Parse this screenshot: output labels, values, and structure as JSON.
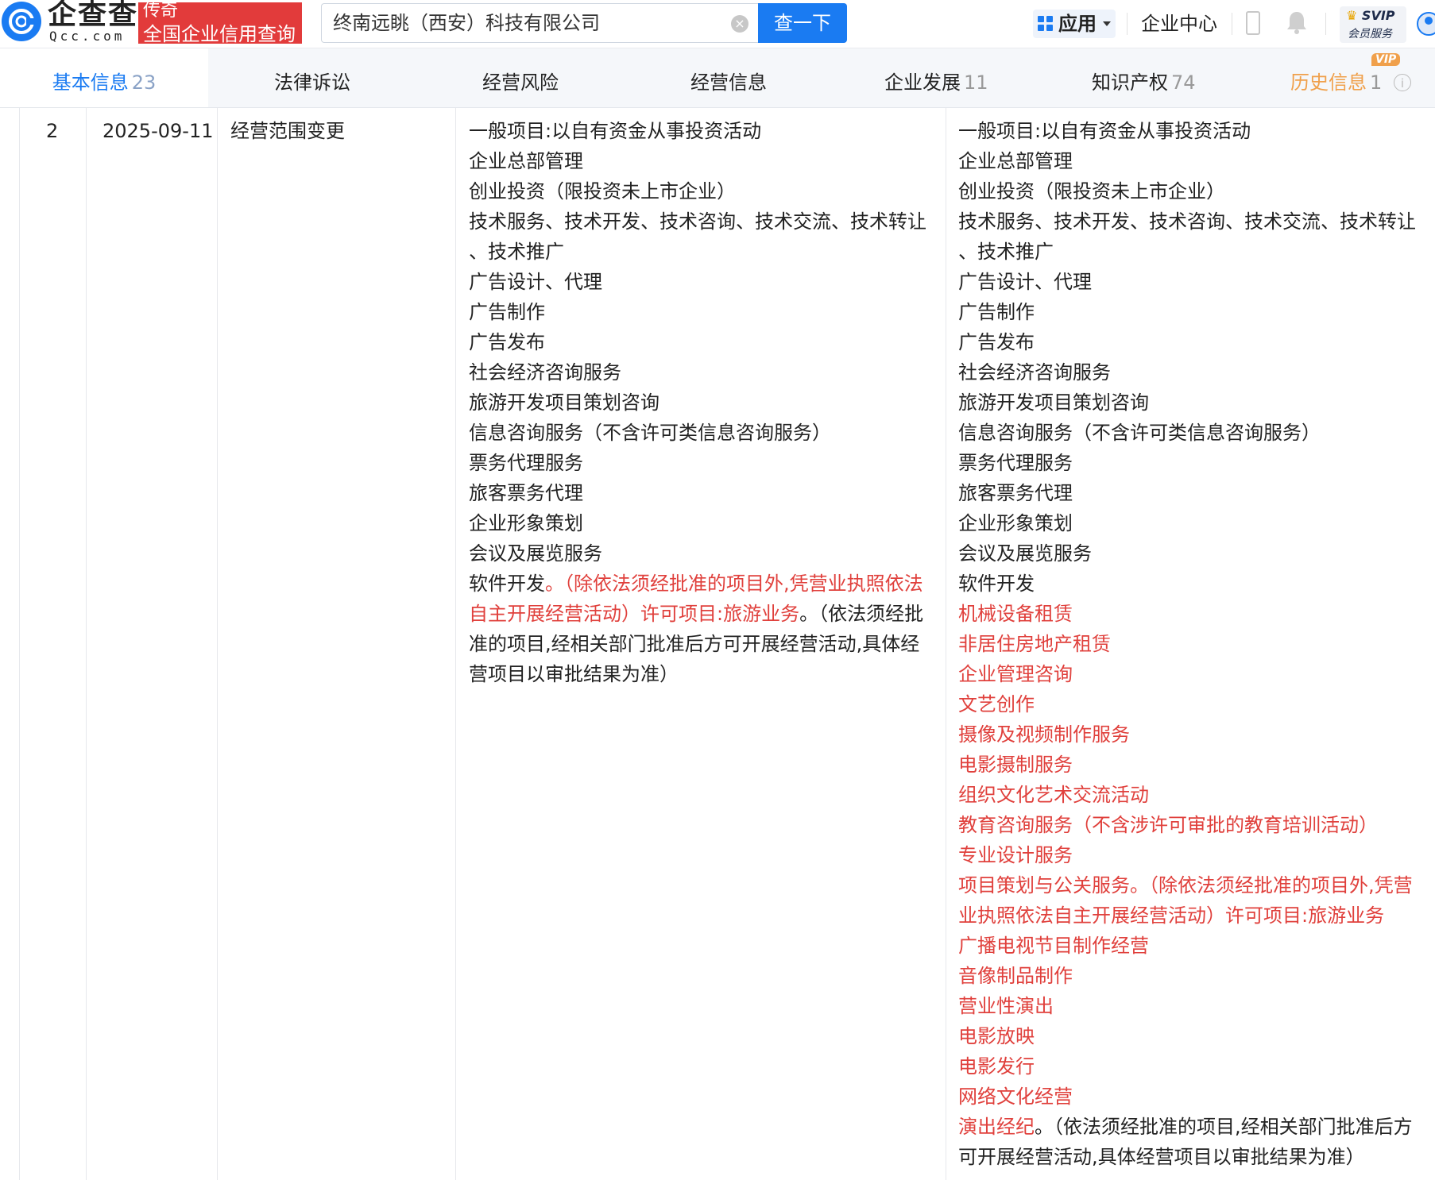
{
  "header": {
    "logo_text": "企查查",
    "logo_sub": "Qcc.com",
    "badge_top": "传奇",
    "badge_bottom": "全国企业信用查询",
    "search_value": "终南远眺（西安）科技有限公司",
    "search_button": "查一下",
    "app_label": "应用",
    "enterprise_center": "企业中心",
    "svip_title": "SVIP",
    "svip_sub": "会员服务"
  },
  "tabs": [
    {
      "label": "基本信息",
      "count": "23"
    },
    {
      "label": "法律诉讼",
      "count": ""
    },
    {
      "label": "经营风险",
      "count": ""
    },
    {
      "label": "经营信息",
      "count": ""
    },
    {
      "label": "企业发展",
      "count": "11"
    },
    {
      "label": "知识产权",
      "count": "74"
    },
    {
      "label": "历史信息",
      "count": "1"
    }
  ],
  "vip_tag": "VIP",
  "record": {
    "index": "2",
    "date": "2025-09-11",
    "type": "经营范围变更",
    "before": [
      [
        {
          "t": "一般项目:以自有资金从事投资活动",
          "r": false
        }
      ],
      [
        {
          "t": "企业总部管理",
          "r": false
        }
      ],
      [
        {
          "t": "创业投资（限投资未上市企业）",
          "r": false
        }
      ],
      [
        {
          "t": "技术服务、技术开发、技术咨询、技术交流、技术转让",
          "r": false
        }
      ],
      [
        {
          "t": "、技术推广",
          "r": false
        }
      ],
      [
        {
          "t": "广告设计、代理",
          "r": false
        }
      ],
      [
        {
          "t": "广告制作",
          "r": false
        }
      ],
      [
        {
          "t": "广告发布",
          "r": false
        }
      ],
      [
        {
          "t": "社会经济咨询服务",
          "r": false
        }
      ],
      [
        {
          "t": "旅游开发项目策划咨询",
          "r": false
        }
      ],
      [
        {
          "t": "信息咨询服务（不含许可类信息咨询服务）",
          "r": false
        }
      ],
      [
        {
          "t": "票务代理服务",
          "r": false
        }
      ],
      [
        {
          "t": "旅客票务代理",
          "r": false
        }
      ],
      [
        {
          "t": "企业形象策划",
          "r": false
        }
      ],
      [
        {
          "t": "会议及展览服务",
          "r": false
        }
      ],
      [
        {
          "t": "软件开发",
          "r": false
        },
        {
          "t": "。（除依法须经批准的项目外,凭营业执照依法",
          "r": true
        }
      ],
      [
        {
          "t": "自主开展经营活动）许可项目:旅游业务",
          "r": true
        },
        {
          "t": "。（依法须经批",
          "r": false
        }
      ],
      [
        {
          "t": "准的项目,经相关部门批准后方可开展经营活动,具体经",
          "r": false
        }
      ],
      [
        {
          "t": "营项目以审批结果为准）",
          "r": false
        }
      ]
    ],
    "after": [
      [
        {
          "t": "一般项目:以自有资金从事投资活动",
          "r": false
        }
      ],
      [
        {
          "t": "企业总部管理",
          "r": false
        }
      ],
      [
        {
          "t": "创业投资（限投资未上市企业）",
          "r": false
        }
      ],
      [
        {
          "t": "技术服务、技术开发、技术咨询、技术交流、技术转让",
          "r": false
        }
      ],
      [
        {
          "t": "、技术推广",
          "r": false
        }
      ],
      [
        {
          "t": "广告设计、代理",
          "r": false
        }
      ],
      [
        {
          "t": "广告制作",
          "r": false
        }
      ],
      [
        {
          "t": "广告发布",
          "r": false
        }
      ],
      [
        {
          "t": "社会经济咨询服务",
          "r": false
        }
      ],
      [
        {
          "t": "旅游开发项目策划咨询",
          "r": false
        }
      ],
      [
        {
          "t": "信息咨询服务（不含许可类信息咨询服务）",
          "r": false
        }
      ],
      [
        {
          "t": "票务代理服务",
          "r": false
        }
      ],
      [
        {
          "t": "旅客票务代理",
          "r": false
        }
      ],
      [
        {
          "t": "企业形象策划",
          "r": false
        }
      ],
      [
        {
          "t": "会议及展览服务",
          "r": false
        }
      ],
      [
        {
          "t": "软件开发",
          "r": false
        }
      ],
      [
        {
          "t": "机械设备租赁",
          "r": true
        }
      ],
      [
        {
          "t": "非居住房地产租赁",
          "r": true
        }
      ],
      [
        {
          "t": "企业管理咨询",
          "r": true
        }
      ],
      [
        {
          "t": "文艺创作",
          "r": true
        }
      ],
      [
        {
          "t": "摄像及视频制作服务",
          "r": true
        }
      ],
      [
        {
          "t": "电影摄制服务",
          "r": true
        }
      ],
      [
        {
          "t": "组织文化艺术交流活动",
          "r": true
        }
      ],
      [
        {
          "t": "教育咨询服务（不含涉许可审批的教育培训活动）",
          "r": true
        }
      ],
      [
        {
          "t": "专业设计服务",
          "r": true
        }
      ],
      [
        {
          "t": "项目策划与公关服务。（除依法须经批准的项目外,凭营",
          "r": true
        }
      ],
      [
        {
          "t": "业执照依法自主开展经营活动）许可项目:旅游业务",
          "r": true
        }
      ],
      [
        {
          "t": "广播电视节目制作经营",
          "r": true
        }
      ],
      [
        {
          "t": "音像制品制作",
          "r": true
        }
      ],
      [
        {
          "t": "营业性演出",
          "r": true
        }
      ],
      [
        {
          "t": "电影放映",
          "r": true
        }
      ],
      [
        {
          "t": "电影发行",
          "r": true
        }
      ],
      [
        {
          "t": "网络文化经营",
          "r": true
        }
      ],
      [
        {
          "t": "演出经纪",
          "r": true
        },
        {
          "t": "。（依法须经批准的项目,经相关部门批准后方",
          "r": false
        }
      ],
      [
        {
          "t": "可开展经营活动,具体经营项目以审批结果为准）",
          "r": false
        }
      ]
    ]
  },
  "colors": {
    "brand_blue": "#1a7bf2",
    "highlight_red": "#e0403c",
    "history_orange": "#f0a04b",
    "badge_red": "#e23b3b"
  },
  "icons": [
    "logo-icon",
    "clear-icon",
    "grid-icon",
    "caret-down-icon",
    "phone-icon",
    "bell-icon",
    "crown-icon",
    "user-icon",
    "info-icon"
  ]
}
